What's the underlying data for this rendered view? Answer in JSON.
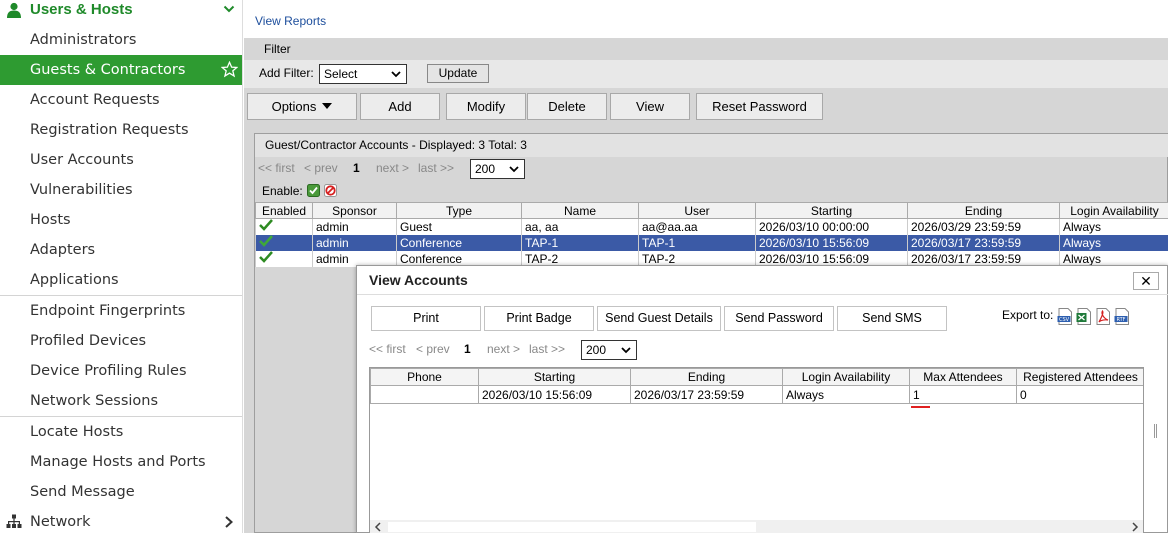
{
  "sidebar": {
    "section_title": "Users & Hosts",
    "items": [
      {
        "label": "Administrators"
      },
      {
        "label": "Guests & Contractors",
        "active": true
      },
      {
        "label": "Account Requests"
      },
      {
        "label": "Registration Requests"
      },
      {
        "label": "User Accounts"
      },
      {
        "label": "Vulnerabilities"
      },
      {
        "label": "Hosts"
      },
      {
        "label": "Adapters"
      },
      {
        "label": "Applications"
      },
      {
        "label": "Endpoint Fingerprints"
      },
      {
        "label": "Profiled Devices"
      },
      {
        "label": "Device Profiling Rules"
      },
      {
        "label": "Network Sessions"
      },
      {
        "label": "Locate Hosts"
      },
      {
        "label": "Manage Hosts and Ports"
      },
      {
        "label": "Send Message"
      }
    ],
    "network_label": "Network",
    "accent_color": "#2e9b31"
  },
  "main": {
    "view_reports": "View Reports",
    "filter_title": "Filter",
    "add_filter_label": "Add Filter:",
    "add_filter_value": "Select",
    "update_button": "Update",
    "actions": {
      "options": "Options",
      "add": "Add",
      "modify": "Modify",
      "delete": "Delete",
      "view": "View",
      "reset_password": "Reset Password"
    },
    "grid": {
      "title": "Guest/Contractor Accounts - Displayed: 3 Total: 3",
      "pager": {
        "first": "<< first",
        "prev": "< prev",
        "page": "1",
        "next": "next >",
        "last": "last >>",
        "page_size": "200"
      },
      "enable_label": "Enable:",
      "columns": [
        "Enabled",
        "Sponsor",
        "Type",
        "Name",
        "User",
        "Starting",
        "Ending",
        "Login Availability"
      ],
      "rows": [
        {
          "sponsor": "admin",
          "type": "Guest",
          "name": "aa, aa",
          "user": "aa@aa.aa",
          "starting": "2026/03/10 00:00:00",
          "ending": "2026/03/29 23:59:59",
          "login": "Always"
        },
        {
          "sponsor": "admin",
          "type": "Conference",
          "name": "TAP-1",
          "user": "TAP-1",
          "starting": "2026/03/10 15:56:09",
          "ending": "2026/03/17 23:59:59",
          "login": "Always",
          "selected": true
        },
        {
          "sponsor": "admin",
          "type": "Conference",
          "name": "TAP-2",
          "user": "TAP-2",
          "starting": "2026/03/10 15:56:09",
          "ending": "2026/03/17 23:59:59",
          "login": "Always"
        }
      ]
    }
  },
  "dialog": {
    "title": "View Accounts",
    "close_glyph": "✕",
    "buttons": {
      "print": "Print",
      "print_badge": "Print Badge",
      "send_guest_details": "Send Guest Details",
      "send_password": "Send Password",
      "send_sms": "Send SMS"
    },
    "export_label": "Export to:",
    "export_icons": [
      "csv-icon",
      "excel-icon",
      "pdf-icon",
      "rtf-icon"
    ],
    "pager": {
      "first": "<< first",
      "prev": "< prev",
      "page": "1",
      "next": "next >",
      "last": "last >>",
      "page_size": "200"
    },
    "columns": [
      "Phone",
      "Starting",
      "Ending",
      "Login Availability",
      "Max Attendees",
      "Registered Attendees"
    ],
    "rows": [
      {
        "phone": "",
        "starting": "2026/03/10 15:56:09",
        "ending": "2026/03/17 23:59:59",
        "login": "Always",
        "max_attendees": "1",
        "registered": "0"
      }
    ]
  }
}
